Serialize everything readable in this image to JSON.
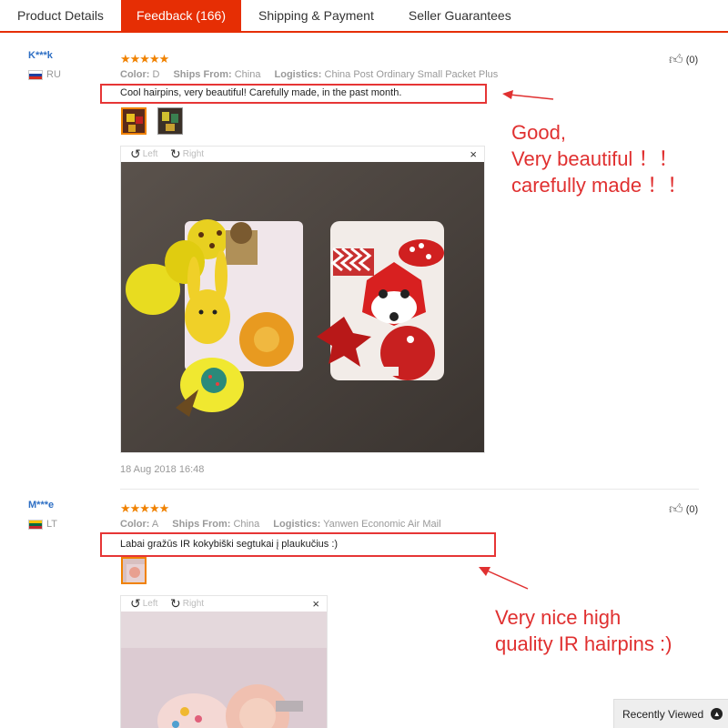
{
  "tabs": [
    {
      "label": "Product Details"
    },
    {
      "label": "Feedback (166)"
    },
    {
      "label": "Shipping & Payment"
    },
    {
      "label": "Seller Guarantees"
    }
  ],
  "labels": {
    "color": "Color:",
    "ships_from": "Ships From:",
    "logistics": "Logistics:",
    "rotate_left": "Left",
    "rotate_right": "Right",
    "close": "×",
    "stars": "★★★★★"
  },
  "reviews": [
    {
      "user": "K***k",
      "country": "RU",
      "rating": 5,
      "color": "D",
      "ships_from": "China",
      "logistics": "China Post Ordinary Small Packet Plus",
      "comment": "Cool hairpins, very beautiful! Carefully made, in the past month.",
      "date": "18 Aug 2018 16:48",
      "likes": "(0)",
      "annotation": [
        "Good,",
        "Very beautiful ！！",
        "carefully made ！！"
      ]
    },
    {
      "user": "M***e",
      "country": "LT",
      "rating": 5,
      "color": "A",
      "ships_from": "China",
      "logistics": "Yanwen Economic Air Mail",
      "comment": "Labai gražūs IR kokybiški segtukai į plaukučius :)",
      "likes": "(0)",
      "annotation": [
        "Very nice high",
        "quality IR hairpins :)"
      ]
    }
  ],
  "recently_viewed": "Recently Viewed",
  "colors": {
    "accent": "#e62e04",
    "annotation_red": "#e03030",
    "stars": "#f08200",
    "user_link": "#2e6fc4"
  }
}
